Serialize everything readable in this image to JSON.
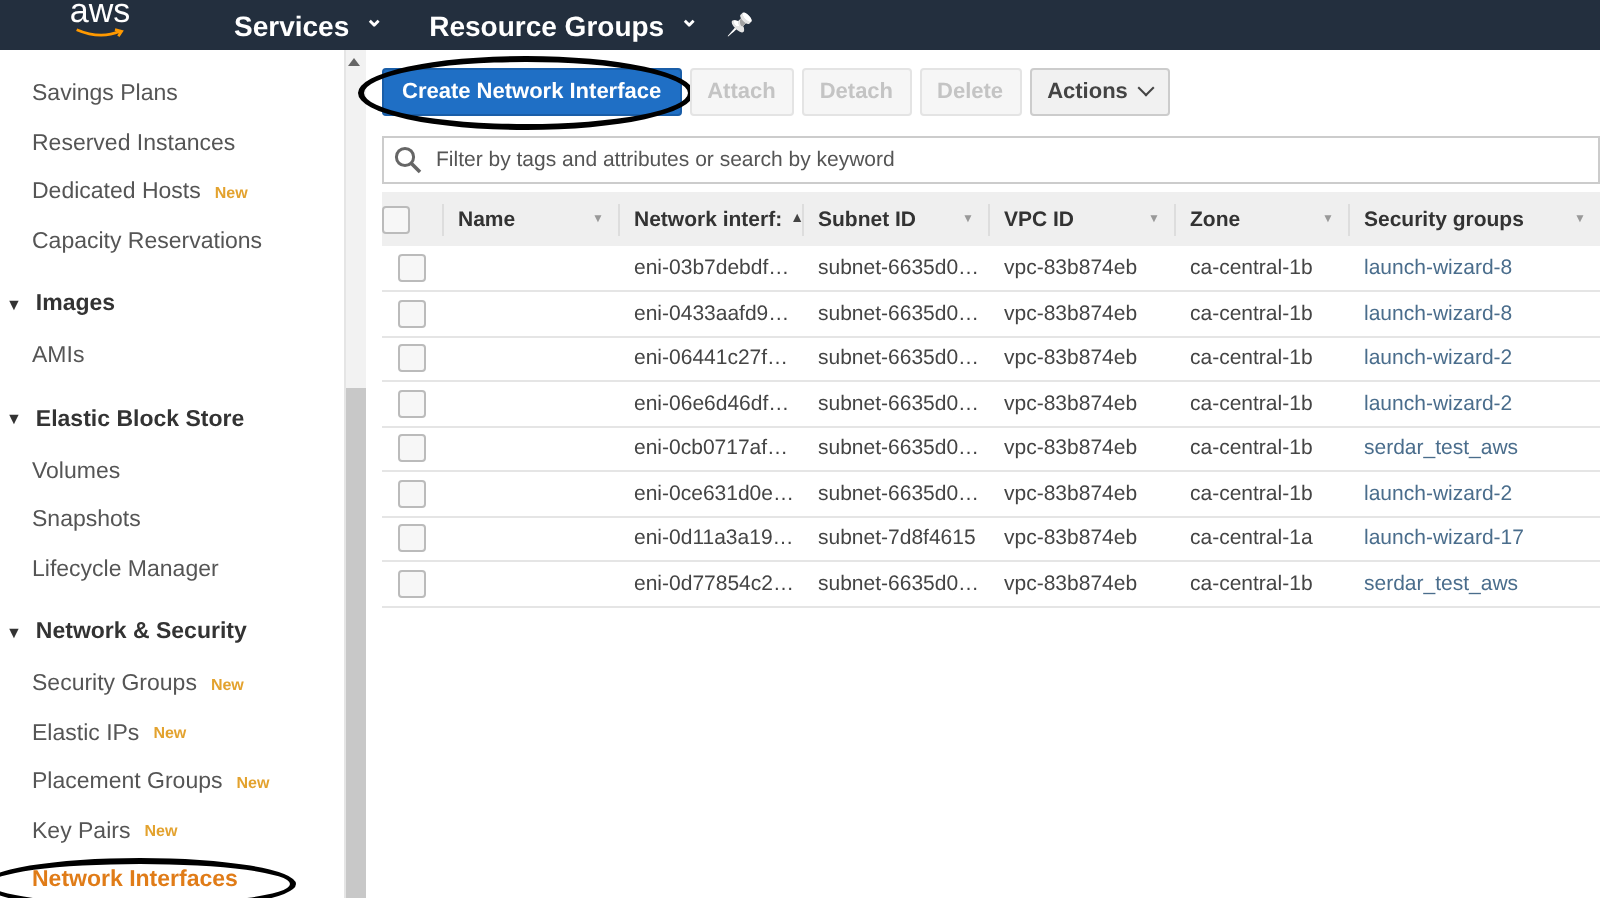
{
  "top_bar": {
    "logo": "aws",
    "menus": [
      {
        "label": "Services",
        "caret": "⌄"
      },
      {
        "label": "Resource Groups",
        "caret": "⌄"
      }
    ],
    "pin": "📌"
  },
  "sidebar": {
    "sections": [
      {
        "items": [
          {
            "label": "Savings Plans",
            "selected": false
          },
          {
            "label": "Reserved Instances",
            "selected": false
          },
          {
            "label": "Dedicated Hosts",
            "badge": "New",
            "selected": false
          },
          {
            "label": "Capacity Reservations",
            "selected": false
          }
        ]
      },
      {
        "toggle": "▼",
        "title": "Images",
        "items": [
          {
            "label": "AMIs",
            "selected": false
          }
        ]
      },
      {
        "toggle": "▼",
        "title": "Elastic Block Store",
        "items": [
          {
            "label": "Volumes",
            "selected": false
          },
          {
            "label": "Snapshots",
            "selected": false
          },
          {
            "label": "Lifecycle Manager",
            "selected": false
          }
        ]
      },
      {
        "toggle": "▼",
        "title": "Network & Security",
        "items": [
          {
            "label": "Security Groups",
            "badge": "New",
            "selected": false
          },
          {
            "label": "Elastic IPs",
            "badge": "New",
            "selected": false
          },
          {
            "label": "Placement Groups",
            "badge": "New",
            "selected": false
          },
          {
            "label": "Key Pairs",
            "badge": "New",
            "selected": false
          },
          {
            "label": "Network Interfaces",
            "selected": true,
            "circled": true
          }
        ]
      }
    ]
  },
  "toolbar": {
    "buttons": [
      {
        "label": "Create Network Interface",
        "kind": "primary",
        "disabled": false,
        "circled": true
      },
      {
        "label": "Attach",
        "kind": "plain",
        "disabled": true
      },
      {
        "label": "Detach",
        "kind": "plain",
        "disabled": true
      },
      {
        "label": "Delete",
        "kind": "plain",
        "disabled": true
      },
      {
        "label": "Actions",
        "kind": "menu",
        "disabled": false
      }
    ]
  },
  "search": {
    "placeholder": "Filter by tags and attributes or search by keyword"
  },
  "table": {
    "all_checked": false,
    "columns": [
      {
        "label": "Name",
        "icon": "▼",
        "sorted": false
      },
      {
        "label": "Network interf:",
        "icon": "▲",
        "sorted": true
      },
      {
        "label": "Subnet ID",
        "icon": "▼",
        "sorted": false
      },
      {
        "label": "VPC ID",
        "icon": "▼",
        "sorted": false
      },
      {
        "label": "Zone",
        "icon": "▼",
        "sorted": false
      },
      {
        "label": "Security groups",
        "icon": "▼",
        "sorted": false
      }
    ],
    "rows": [
      {
        "checked": false,
        "cells": [
          "",
          "eni-03b7debdf…",
          "subnet-6635d0…",
          "vpc-83b874eb",
          "ca-central-1b",
          "launch-wizard-8"
        ]
      },
      {
        "checked": false,
        "cells": [
          "",
          "eni-0433aafd9…",
          "subnet-6635d0…",
          "vpc-83b874eb",
          "ca-central-1b",
          "launch-wizard-8"
        ]
      },
      {
        "checked": false,
        "cells": [
          "",
          "eni-06441c27f…",
          "subnet-6635d0…",
          "vpc-83b874eb",
          "ca-central-1b",
          "launch-wizard-2"
        ]
      },
      {
        "checked": false,
        "cells": [
          "",
          "eni-06e6d46df…",
          "subnet-6635d0…",
          "vpc-83b874eb",
          "ca-central-1b",
          "launch-wizard-2"
        ]
      },
      {
        "checked": false,
        "cells": [
          "",
          "eni-0cb0717af…",
          "subnet-6635d0…",
          "vpc-83b874eb",
          "ca-central-1b",
          "serdar_test_aws"
        ]
      },
      {
        "checked": false,
        "cells": [
          "",
          "eni-0ce631d0e…",
          "subnet-6635d0…",
          "vpc-83b874eb",
          "ca-central-1b",
          "launch-wizard-2"
        ]
      },
      {
        "checked": false,
        "cells": [
          "",
          "eni-0d11a3a19…",
          "subnet-7d8f4615",
          "vpc-83b874eb",
          "ca-central-1a",
          "launch-wizard-17"
        ]
      },
      {
        "checked": false,
        "cells": [
          "",
          "eni-0d77854c2…",
          "subnet-6635d0…",
          "vpc-83b874eb",
          "ca-central-1b",
          "serdar_test_aws"
        ]
      }
    ]
  }
}
